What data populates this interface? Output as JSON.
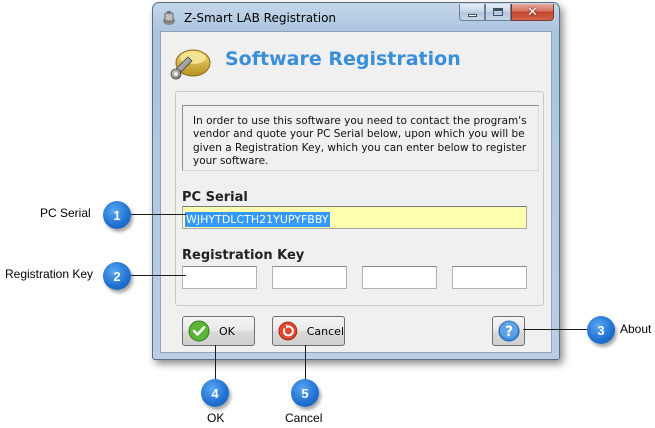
{
  "window": {
    "title": "Z-Smart LAB Registration",
    "close_glyph": "✕"
  },
  "banner": {
    "title": "Software Registration",
    "icon": "key-lock-icon"
  },
  "info": {
    "text": "In order to use this software you need to contact the program's vendor and quote your PC Serial below, upon which you will be given a Registration Key, which you can enter below to register your software."
  },
  "pc_serial": {
    "label": "PC Serial",
    "value": "WJHYTDLCTH21YUPYFBBY"
  },
  "registration_key": {
    "label": "Registration Key",
    "fields": [
      "",
      "",
      "",
      ""
    ]
  },
  "buttons": {
    "ok": "OK",
    "cancel": "Cancel",
    "about_icon": "help-icon"
  },
  "callouts": [
    {
      "number": "1",
      "label": "PC Serial"
    },
    {
      "number": "2",
      "label": "Registration Key"
    },
    {
      "number": "3",
      "label": "About"
    },
    {
      "number": "4",
      "label": "OK"
    },
    {
      "number": "5",
      "label": "Cancel"
    }
  ],
  "colors": {
    "accent_title": "#3a8fd8",
    "serial_background": "#ffffb0",
    "selection": "#3399ff",
    "callout_marker": "#1f6fd0"
  }
}
